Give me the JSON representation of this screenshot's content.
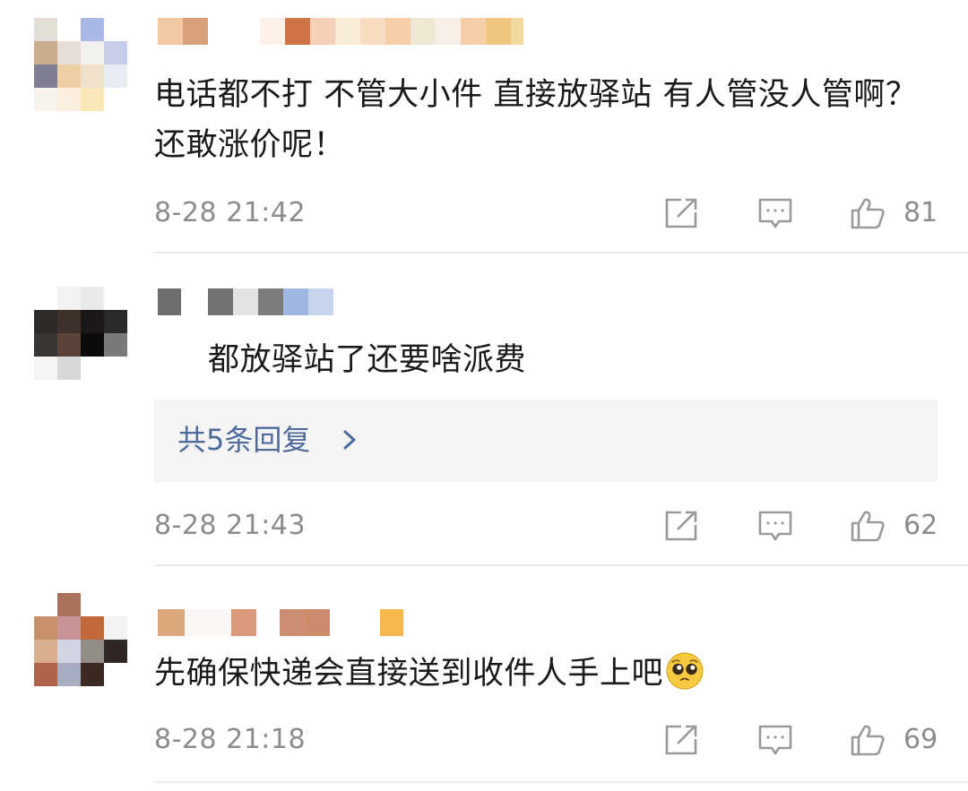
{
  "comments": [
    {
      "text": "电话都不打  不管大小件 直接放驿站  有人管没人管啊？还敢涨价呢！",
      "time": "8-28 21:42",
      "likes": "81",
      "username": ""
    },
    {
      "text": "都放驿站了还要啥派费",
      "time": "8-28 21:43",
      "likes": "62",
      "username": "",
      "replies_label": "共5条回复"
    },
    {
      "text": "先确保快递会直接送到收件人手上吧",
      "emoji": "pleading-face",
      "time": "8-28 21:18",
      "likes": "69",
      "username": ""
    }
  ],
  "icons": {
    "share": "share-icon",
    "reply": "comment-icon",
    "like": "thumbs-up-icon",
    "chevron": "chevron-right-icon"
  },
  "colors": {
    "meta_gray": "#8c8c8c",
    "reply_link_blue": "#4d6a9a",
    "reply_panel_bg": "#f4f4f4"
  }
}
